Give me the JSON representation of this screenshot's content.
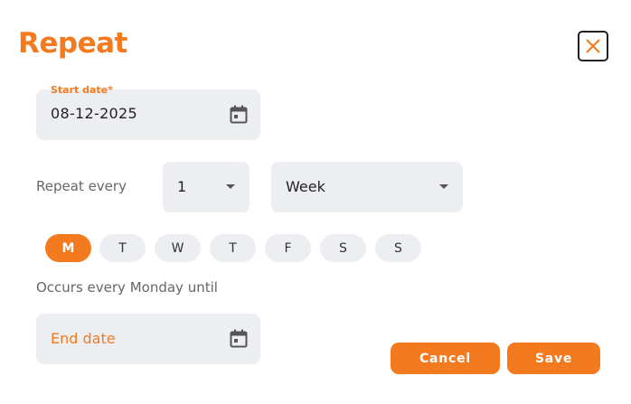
{
  "dialog": {
    "title": "Repeat",
    "close_icon": "close-icon"
  },
  "start_date": {
    "label": "Start date*",
    "value": "08-12-2025",
    "icon": "calendar-icon"
  },
  "repeat": {
    "label": "Repeat every",
    "count": "1",
    "unit": "Week"
  },
  "days": [
    {
      "label": "M",
      "selected": true
    },
    {
      "label": "T",
      "selected": false
    },
    {
      "label": "W",
      "selected": false
    },
    {
      "label": "T",
      "selected": false
    },
    {
      "label": "F",
      "selected": false
    },
    {
      "label": "S",
      "selected": false
    },
    {
      "label": "S",
      "selected": false
    }
  ],
  "summary": "Occurs every Monday until",
  "end_date": {
    "placeholder": "End date",
    "icon": "calendar-icon"
  },
  "actions": {
    "cancel": "Cancel",
    "save": "Save"
  },
  "colors": {
    "accent": "#f47a20",
    "field_bg": "#eceef1"
  }
}
